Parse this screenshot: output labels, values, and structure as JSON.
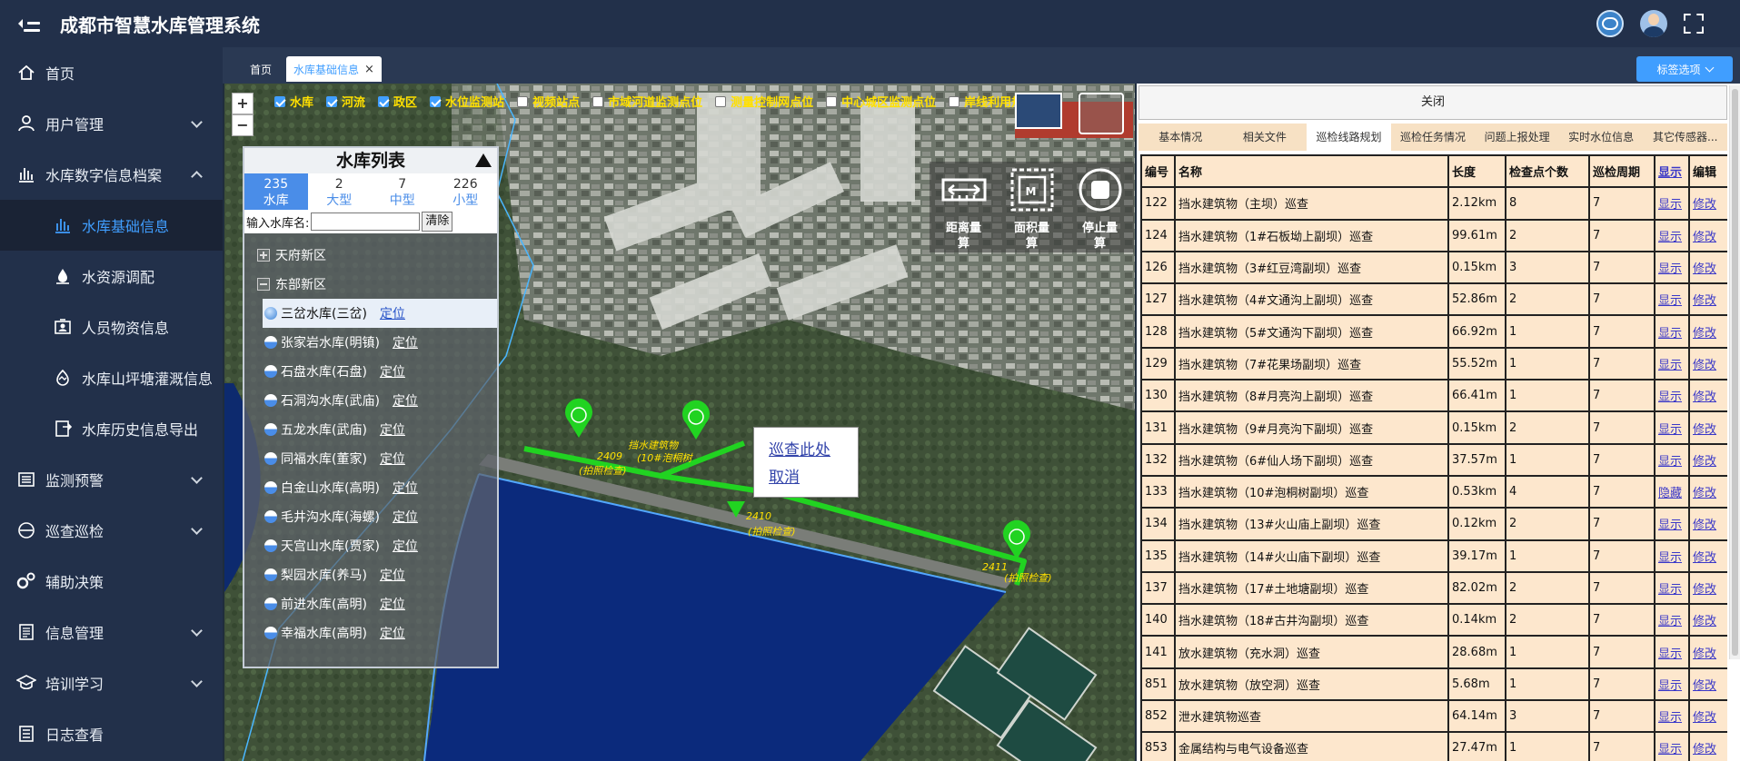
{
  "app": {
    "title": "成都市智慧水库管理系统"
  },
  "sidebar": {
    "items": [
      {
        "label": "首页",
        "icon": "home-icon"
      },
      {
        "label": "用户管理",
        "icon": "user-icon"
      },
      {
        "label": "水库数字信息档案",
        "icon": "bar-chart-icon"
      },
      {
        "label": "水库基础信息",
        "icon": "bar-chart-icon"
      },
      {
        "label": "水资源调配",
        "icon": "water-drop-icon"
      },
      {
        "label": "人员物资信息",
        "icon": "id-card-icon"
      },
      {
        "label": "水库山坪塘灌溉信息",
        "icon": "mountain-icon"
      },
      {
        "label": "水库历史信息导出",
        "icon": "export-icon"
      },
      {
        "label": "监测预警",
        "icon": "list-icon"
      },
      {
        "label": "巡查巡检",
        "icon": "circle-minus-icon"
      },
      {
        "label": "辅助决策",
        "icon": "cogs-icon"
      },
      {
        "label": "信息管理",
        "icon": "document-icon"
      },
      {
        "label": "培训学习",
        "icon": "graduation-icon"
      },
      {
        "label": "日志查看",
        "icon": "log-icon"
      }
    ]
  },
  "tabs": {
    "home": "首页",
    "active": "水库基础信息",
    "close": "×",
    "tag_options": "标签选项"
  },
  "map": {
    "layers": [
      {
        "label": "水库",
        "checked": true
      },
      {
        "label": "河流",
        "checked": true
      },
      {
        "label": "政区",
        "checked": true
      },
      {
        "label": "水位监测站",
        "checked": true
      },
      {
        "label": "视频站点",
        "checked": false
      },
      {
        "label": "市域河道监测点位",
        "checked": false
      },
      {
        "label": "测量控制网点位",
        "checked": false
      },
      {
        "label": "中心城区监测点位",
        "checked": false
      },
      {
        "label": "岸线利用规划",
        "checked": false
      }
    ],
    "zoom_in": "+",
    "zoom_out": "−",
    "tools": [
      {
        "label1": "距离量",
        "label2": "算"
      },
      {
        "label1": "面积量",
        "label2": "算"
      },
      {
        "label1": "停止量",
        "label2": "算"
      }
    ],
    "measure_m": "M",
    "popup": {
      "inspect": "巡查此处",
      "cancel": "取消"
    },
    "labels": [
      {
        "text": "挡水建筑物"
      },
      {
        "text": "(10#泡桐树"
      },
      {
        "text": "2409"
      },
      {
        "text": "(拍照检查)"
      },
      {
        "text": "2410"
      },
      {
        "text": "(拍照检查)"
      },
      {
        "text": "2411"
      },
      {
        "text": "(拍照检查)"
      }
    ]
  },
  "reservoir_list": {
    "title": "水库列表",
    "stats": [
      {
        "count": "235",
        "label": "水库"
      },
      {
        "count": "2",
        "label": "大型"
      },
      {
        "count": "7",
        "label": "中型"
      },
      {
        "count": "226",
        "label": "小型"
      }
    ],
    "search_label": "输入水库名:",
    "search_value": "",
    "clear": "清除",
    "groups": [
      {
        "name": "天府新区",
        "expanded": false
      },
      {
        "name": "东部新区",
        "expanded": true
      }
    ],
    "locate": "定位",
    "items": [
      "三岔水库(三岔)",
      "张家岩水库(明镇)",
      "石盘水库(石盘)",
      "石洞沟水库(武庙)",
      "五龙水库(武庙)",
      "同福水库(董家)",
      "白金山水库(高明)",
      "毛井沟水库(海螺)",
      "天宫山水库(贾家)",
      "梨园水库(养马)",
      "前进水库(高明)",
      "幸福水库(高明)"
    ]
  },
  "panel": {
    "close": "关闭",
    "tabs": [
      "基本情况",
      "相关文件",
      "巡检线路规划",
      "巡检任务情况",
      "问题上报处理",
      "实时水位信息",
      "其它传感器..."
    ],
    "columns": [
      "编号",
      "名称",
      "长度",
      "检查点个数",
      "巡检周期",
      "显示",
      "编辑"
    ],
    "rows": [
      [
        "122",
        "挡水建筑物（主坝）巡查",
        "2.12km",
        "8",
        "7",
        "显示",
        "修改"
      ],
      [
        "124",
        "挡水建筑物（1#石板坳上副坝）巡查",
        "99.61m",
        "2",
        "7",
        "显示",
        "修改"
      ],
      [
        "126",
        "挡水建筑物（3#红豆湾副坝）巡查",
        "0.15km",
        "3",
        "7",
        "显示",
        "修改"
      ],
      [
        "127",
        "挡水建筑物（4#文通沟上副坝）巡查",
        "52.86m",
        "2",
        "7",
        "显示",
        "修改"
      ],
      [
        "128",
        "挡水建筑物（5#文通沟下副坝）巡查",
        "66.92m",
        "1",
        "7",
        "显示",
        "修改"
      ],
      [
        "129",
        "挡水建筑物（7#花果场副坝）巡查",
        "55.52m",
        "1",
        "7",
        "显示",
        "修改"
      ],
      [
        "130",
        "挡水建筑物（8#月亮沟上副坝）巡查",
        "66.41m",
        "1",
        "7",
        "显示",
        "修改"
      ],
      [
        "131",
        "挡水建筑物（9#月亮沟下副坝）巡查",
        "0.15km",
        "2",
        "7",
        "显示",
        "修改"
      ],
      [
        "132",
        "挡水建筑物（6#仙人场下副坝）巡查",
        "37.57m",
        "1",
        "7",
        "显示",
        "修改"
      ],
      [
        "133",
        "挡水建筑物（10#泡桐树副坝）巡查",
        "0.53km",
        "4",
        "7",
        "隐藏",
        "修改"
      ],
      [
        "134",
        "挡水建筑物（13#火山庙上副坝）巡查",
        "0.12km",
        "2",
        "7",
        "显示",
        "修改"
      ],
      [
        "135",
        "挡水建筑物（14#火山庙下副坝）巡查",
        "39.17m",
        "1",
        "7",
        "显示",
        "修改"
      ],
      [
        "137",
        "挡水建筑物（17#土地塘副坝）巡查",
        "82.02m",
        "2",
        "7",
        "显示",
        "修改"
      ],
      [
        "140",
        "挡水建筑物（18#古井沟副坝）巡查",
        "0.14km",
        "2",
        "7",
        "显示",
        "修改"
      ],
      [
        "141",
        "放水建筑物（充水洞）巡查",
        "28.68m",
        "1",
        "7",
        "显示",
        "修改"
      ],
      [
        "851",
        "放水建筑物（放空洞）巡查",
        "5.68m",
        "1",
        "7",
        "显示",
        "修改"
      ],
      [
        "852",
        "泄水建筑物巡查",
        "64.14m",
        "3",
        "7",
        "显示",
        "修改"
      ],
      [
        "853",
        "金属结构与电气设备巡查",
        "27.47m",
        "1",
        "7",
        "显示",
        "修改"
      ]
    ]
  },
  "colors": {
    "accent": "#409eff",
    "sidebar_bg": "#22304a",
    "route": "#21d321",
    "table_bg": "#fde7cd",
    "label_yellow": "#ffe000"
  }
}
